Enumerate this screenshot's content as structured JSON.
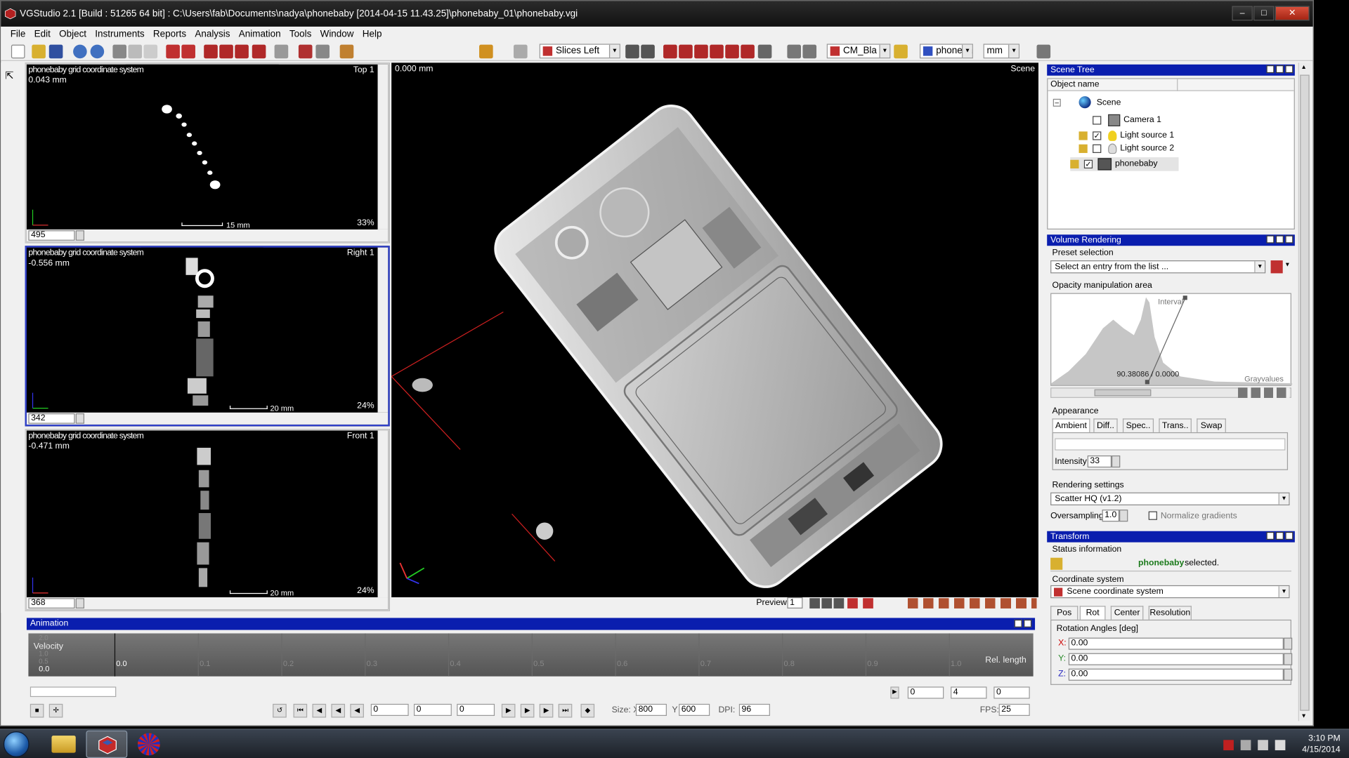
{
  "window": {
    "title": "VGStudio 2.1   [Build : 51265   64 bit] :  C:\\Users\\fab\\Documents\\nadya\\phonebaby [2014-04-15 11.43.25]\\phonebaby_01\\phonebaby.vgi"
  },
  "menu": [
    "File",
    "Edit",
    "Object",
    "Instruments",
    "Reports",
    "Analysis",
    "Animation",
    "Tools",
    "Window",
    "Help"
  ],
  "toolbar": {
    "layout_combo": "Slices Left",
    "colormap_combo": "CM_Bla",
    "object_combo": "phoneba",
    "unit_combo": "mm"
  },
  "views": {
    "top": {
      "label": "phonebaby grid coordinate system",
      "position": "0.043 mm",
      "name": "Top 1",
      "zoom": "33%",
      "scale": "15 mm",
      "slice": "495"
    },
    "right": {
      "label": "phonebaby grid coordinate system",
      "position": "-0.556 mm",
      "name": "Right 1",
      "zoom": "24%",
      "scale": "20 mm",
      "slice": "342"
    },
    "front": {
      "label": "phonebaby grid coordinate system",
      "position": "-0.471 mm",
      "name": "Front 1",
      "zoom": "24%",
      "scale": "20 mm",
      "slice": "368"
    }
  },
  "view3d": {
    "position": "0.000 mm",
    "name": "Scene",
    "preview_label": "Preview:",
    "preview_value": "1"
  },
  "scene_tree": {
    "title": "Scene Tree",
    "column": "Object name",
    "nodes": [
      "Scene",
      "Camera 1",
      "Light source 1",
      "Light source 2",
      "phonebaby"
    ]
  },
  "volume_rendering": {
    "title": "Volume Rendering",
    "preset_label": "Preset selection",
    "preset_placeholder": "Select an entry from the list ...",
    "opacity_label": "Opacity manipulation area",
    "interval": "Interval",
    "point_readout": "90.38086 / 0.0000",
    "grayvalues": "Grayvalues",
    "appearance_label": "Appearance",
    "tabs": [
      "Ambient",
      "Diff..",
      "Spec..",
      "Trans..",
      "Swap"
    ],
    "intensity_label": "Intensity:",
    "intensity_value": "33",
    "rendering_settings_label": "Rendering settings",
    "renderer": "Scatter HQ (v1.2)",
    "oversampling_label": "Oversampling:",
    "oversampling_value": "1.0",
    "normalize_label": "Normalize gradients"
  },
  "transform": {
    "title": "Transform",
    "status_label": "Status information",
    "status_object": "phonebaby",
    "status_suffix": "selected.",
    "coord_label": "Coordinate system",
    "coord_value": "Scene coordinate system",
    "tabs": [
      "Pos",
      "Rot",
      "Center",
      "Resolution"
    ],
    "rotation_label": "Rotation Angles [deg]",
    "x": "0.00",
    "y": "0.00",
    "z": "0.00"
  },
  "animation": {
    "title": "Animation",
    "velocity": "Velocity",
    "y_values": [
      "2.0",
      "1.5",
      "1.0",
      "0.5",
      "0.0"
    ],
    "x_values": [
      "0.0",
      "0.1",
      "0.2",
      "0.3",
      "0.4",
      "0.5",
      "0.6",
      "0.7",
      "0.8",
      "0.9",
      "1.0"
    ],
    "rel_length": "Rel. length",
    "frames": [
      "0",
      "4",
      "0"
    ],
    "playback": [
      "0",
      "0",
      "0"
    ],
    "size_label": "Size: X",
    "size_x": "800",
    "size_y_label": "Y",
    "size_y": "600",
    "dpi_label": "DPI:",
    "dpi": "96",
    "fps_label": "FPS:",
    "fps": "25"
  },
  "taskbar": {
    "time": "3:10 PM",
    "date": "4/15/2014"
  }
}
